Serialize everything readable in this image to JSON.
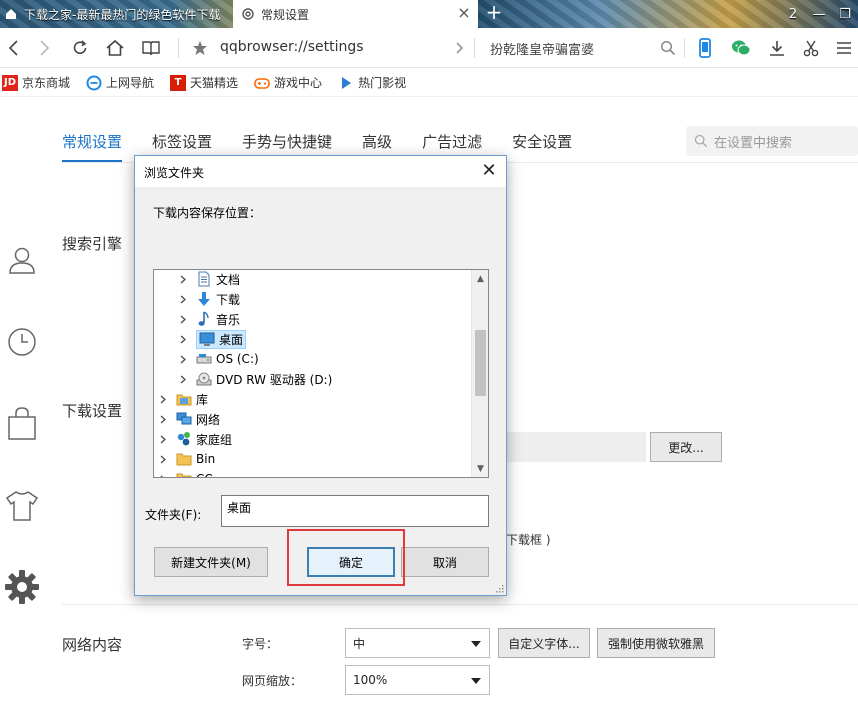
{
  "tabs": [
    {
      "title": "下载之家-最新最热门的绿色软件下载",
      "favicon": "home-favicon",
      "active": false
    },
    {
      "title": "常规设置",
      "favicon": "gear-icon",
      "active": true
    }
  ],
  "window": {
    "counter": "2"
  },
  "address_bar": {
    "url": "qqbrowser://settings",
    "search_text": "扮乾隆皇帝骗富婆"
  },
  "bookmarks": [
    {
      "label": "京东商城",
      "icon": "jd-icon",
      "badge": "JD",
      "color": "#e1251b"
    },
    {
      "label": "上网导航",
      "icon": "ie-nav-icon",
      "color": "#1e88e5"
    },
    {
      "label": "天猫精选",
      "icon": "tmall-icon",
      "badge": "T",
      "color": "#d81e06"
    },
    {
      "label": "游戏中心",
      "icon": "gamepad-icon",
      "color": "#ff6a00"
    },
    {
      "label": "热门影视",
      "icon": "play-icon",
      "color": "#2f7bd8"
    }
  ],
  "settings": {
    "tabs": [
      "常规设置",
      "标签设置",
      "手势与快捷键",
      "高级",
      "广告过滤",
      "安全设置"
    ],
    "active_tab": "常规设置",
    "search_placeholder": "在设置中搜索",
    "sections": {
      "search_engine": "搜索引擎",
      "download": "下载设置",
      "web_content": "网络内容"
    },
    "download": {
      "change_button": "更改...",
      "partial_text": "下载框 )"
    },
    "web_content": {
      "font_size_label": "字号：",
      "font_size_value": "中",
      "custom_font_button": "自定义字体...",
      "force_yahei_button": "强制使用微软雅黑",
      "zoom_label": "网页缩放：",
      "zoom_value": "100%"
    }
  },
  "dialog": {
    "title": "浏览文件夹",
    "prompt": "下载内容保存位置：",
    "tree": [
      {
        "label": "文档",
        "icon": "document-icon",
        "level": 1,
        "selected": false
      },
      {
        "label": "下载",
        "icon": "download-arrow-icon",
        "level": 1,
        "selected": false
      },
      {
        "label": "音乐",
        "icon": "music-note-icon",
        "level": 1,
        "selected": false
      },
      {
        "label": "桌面",
        "icon": "desktop-icon",
        "level": 1,
        "selected": true
      },
      {
        "label": "OS (C:)",
        "icon": "drive-icon",
        "level": 1,
        "selected": false
      },
      {
        "label": "DVD RW 驱动器 (D:)",
        "icon": "dvd-drive-icon",
        "level": 1,
        "selected": false
      },
      {
        "label": "库",
        "icon": "library-icon",
        "level": 0,
        "selected": false
      },
      {
        "label": "网络",
        "icon": "network-icon",
        "level": 0,
        "selected": false
      },
      {
        "label": "家庭组",
        "icon": "homegroup-icon",
        "level": 0,
        "selected": false
      },
      {
        "label": "Bin",
        "icon": "folder-icon",
        "level": 0,
        "selected": false
      },
      {
        "label": "CC",
        "icon": "folder-icon",
        "level": 0,
        "selected": false
      }
    ],
    "folder_label": "文件夹(F):",
    "folder_value": "桌面",
    "new_folder_button": "新建文件夹(M)",
    "ok_button": "确定",
    "cancel_button": "取消"
  },
  "colors": {
    "accent": "#1a73c8",
    "highlight_box": "#e03a3a",
    "selection": "#cce8ff"
  }
}
